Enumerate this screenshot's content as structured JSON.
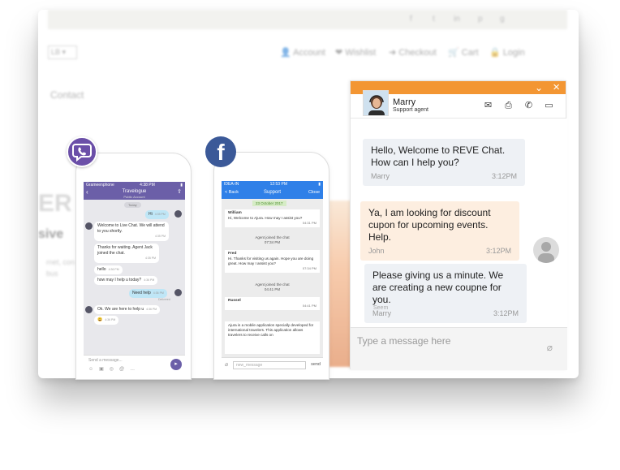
{
  "site": {
    "social_icons": [
      "f",
      "t",
      "in",
      "p",
      "g"
    ],
    "nav": [
      "Account",
      "Wishlist",
      "Checkout",
      "Cart",
      "Login"
    ],
    "select_value": "LB",
    "contact": "Contact",
    "hero_big": "ER",
    "hero_sub": "sive",
    "hero_small": "rnet, con ur id bus"
  },
  "viber": {
    "badge_icon": "viber-logo-icon",
    "carrier": "Grameenphone",
    "time": "4:38 PM",
    "title": "Travelogue",
    "subtitle": "Public Account",
    "day": "Today",
    "messages": [
      {
        "text": "Hi",
        "time": "4:35 PM",
        "dir": "out"
      },
      {
        "text": "Welcome to Live Chat. We will attend to you shortly.",
        "time": "4:35 PM",
        "dir": "in"
      },
      {
        "text": "Thanks for waiting. Agent Jack joined the chat.",
        "time": "4:35 PM",
        "dir": "in"
      },
      {
        "text": "hello",
        "time": "4:36 PM",
        "dir": "in"
      },
      {
        "text": "how may I help u today?",
        "time": "4:36 PM",
        "dir": "in"
      },
      {
        "text": "Need help",
        "time": "4:36 PM",
        "dir": "out"
      },
      {
        "text": "Delivered",
        "time": "",
        "dir": "meta"
      },
      {
        "text": "Ok. We are here to help u",
        "time": "4:36 PM",
        "dir": "in"
      },
      {
        "text": "😀",
        "time": "4:36 PM",
        "dir": "in"
      }
    ],
    "input_placeholder": "Send a message..."
  },
  "facebook": {
    "carrier": "IDEA-IN",
    "time": "12:53 PM",
    "back": "< Back",
    "title": "Support",
    "close": "Close",
    "date": "23 October 2017",
    "william_name": "William",
    "william_text": "Hi, Welcome to Ajura. How may I assist you?",
    "william_time": "04:31 PM",
    "sys1": "Agent joined the chat",
    "sys1_time": "07:34 PM",
    "fred_name": "Fred",
    "fred_text": "Hi. Thanks for visiting us again. Hope you are doing great. How may I assist you?",
    "fred_time": "07:34 PM",
    "sys2": "Agent joined the chat",
    "sys2_time": "04:41 PM",
    "russel_name": "Russel",
    "russel_time": "04:41 PM",
    "long_text": "Ajura is a mobile application specially developed for international travelers. This application allows travelers to receive calls on",
    "input_placeholder": "new_message",
    "send": "send"
  },
  "widget": {
    "accent": "#f39633",
    "agent_name": "Marry",
    "agent_role": "Support agent",
    "messages": [
      {
        "text": "Hello, Welcome to REVE Chat. How can I help you?",
        "author": "Marry",
        "time": "3:12PM"
      },
      {
        "text": "Ya, I am looking for discount cupon for upcoming events. Help.",
        "author": "John",
        "time": "3:12PM"
      },
      {
        "text": "Please giving us a minute. We are creating a new coupne for you.",
        "author": "Marry",
        "time": "3:12PM"
      }
    ],
    "seen": "Seem",
    "input_placeholder": "Type a message here"
  }
}
